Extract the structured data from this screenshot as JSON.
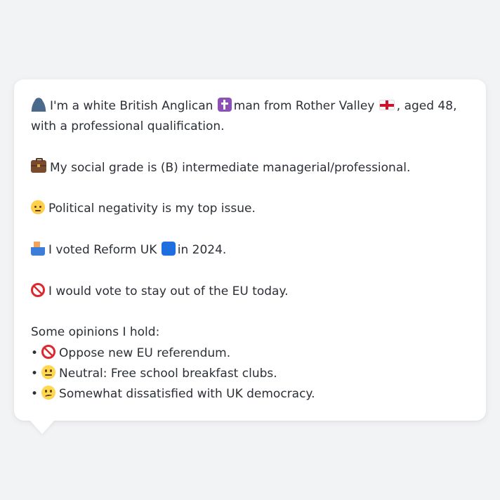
{
  "persona": {
    "identity": {
      "text_before_cross": "I'm a white British Anglican",
      "text_before_flag": "man from Rother Valley",
      "text_after_flag": ", aged 48, with a professional qualification.",
      "icons": [
        "person-silhouette-icon",
        "latin-cross-icon",
        "england-flag-icon"
      ]
    },
    "social_grade": {
      "text": "My social grade is (B) intermediate managerial/professional.",
      "icon": "briefcase-icon"
    },
    "top_issue": {
      "text": "Political negativity is my top issue.",
      "icon": "angry-face-icon"
    },
    "vote_2024": {
      "text_before": "I voted Reform UK",
      "text_after": "in 2024.",
      "icons": [
        "ballot-box-icon",
        "blue-square-icon"
      ]
    },
    "eu_stance": {
      "text": "I would vote to stay out of the EU today.",
      "icon": "no-entry-icon"
    },
    "opinions": {
      "heading": "Some opinions I hold:",
      "bullet": "•",
      "items": [
        {
          "text": "Oppose new EU referendum.",
          "icon": "no-entry-icon"
        },
        {
          "text": "Neutral: Free school breakfast clubs.",
          "icon": "neutral-face-icon"
        },
        {
          "text": "Somewhat dissatisfied with UK democracy.",
          "icon": "confused-face-icon"
        }
      ]
    }
  },
  "colors": {
    "background": "#f2f3f5",
    "card": "#ffffff",
    "text": "#2b2f36"
  }
}
